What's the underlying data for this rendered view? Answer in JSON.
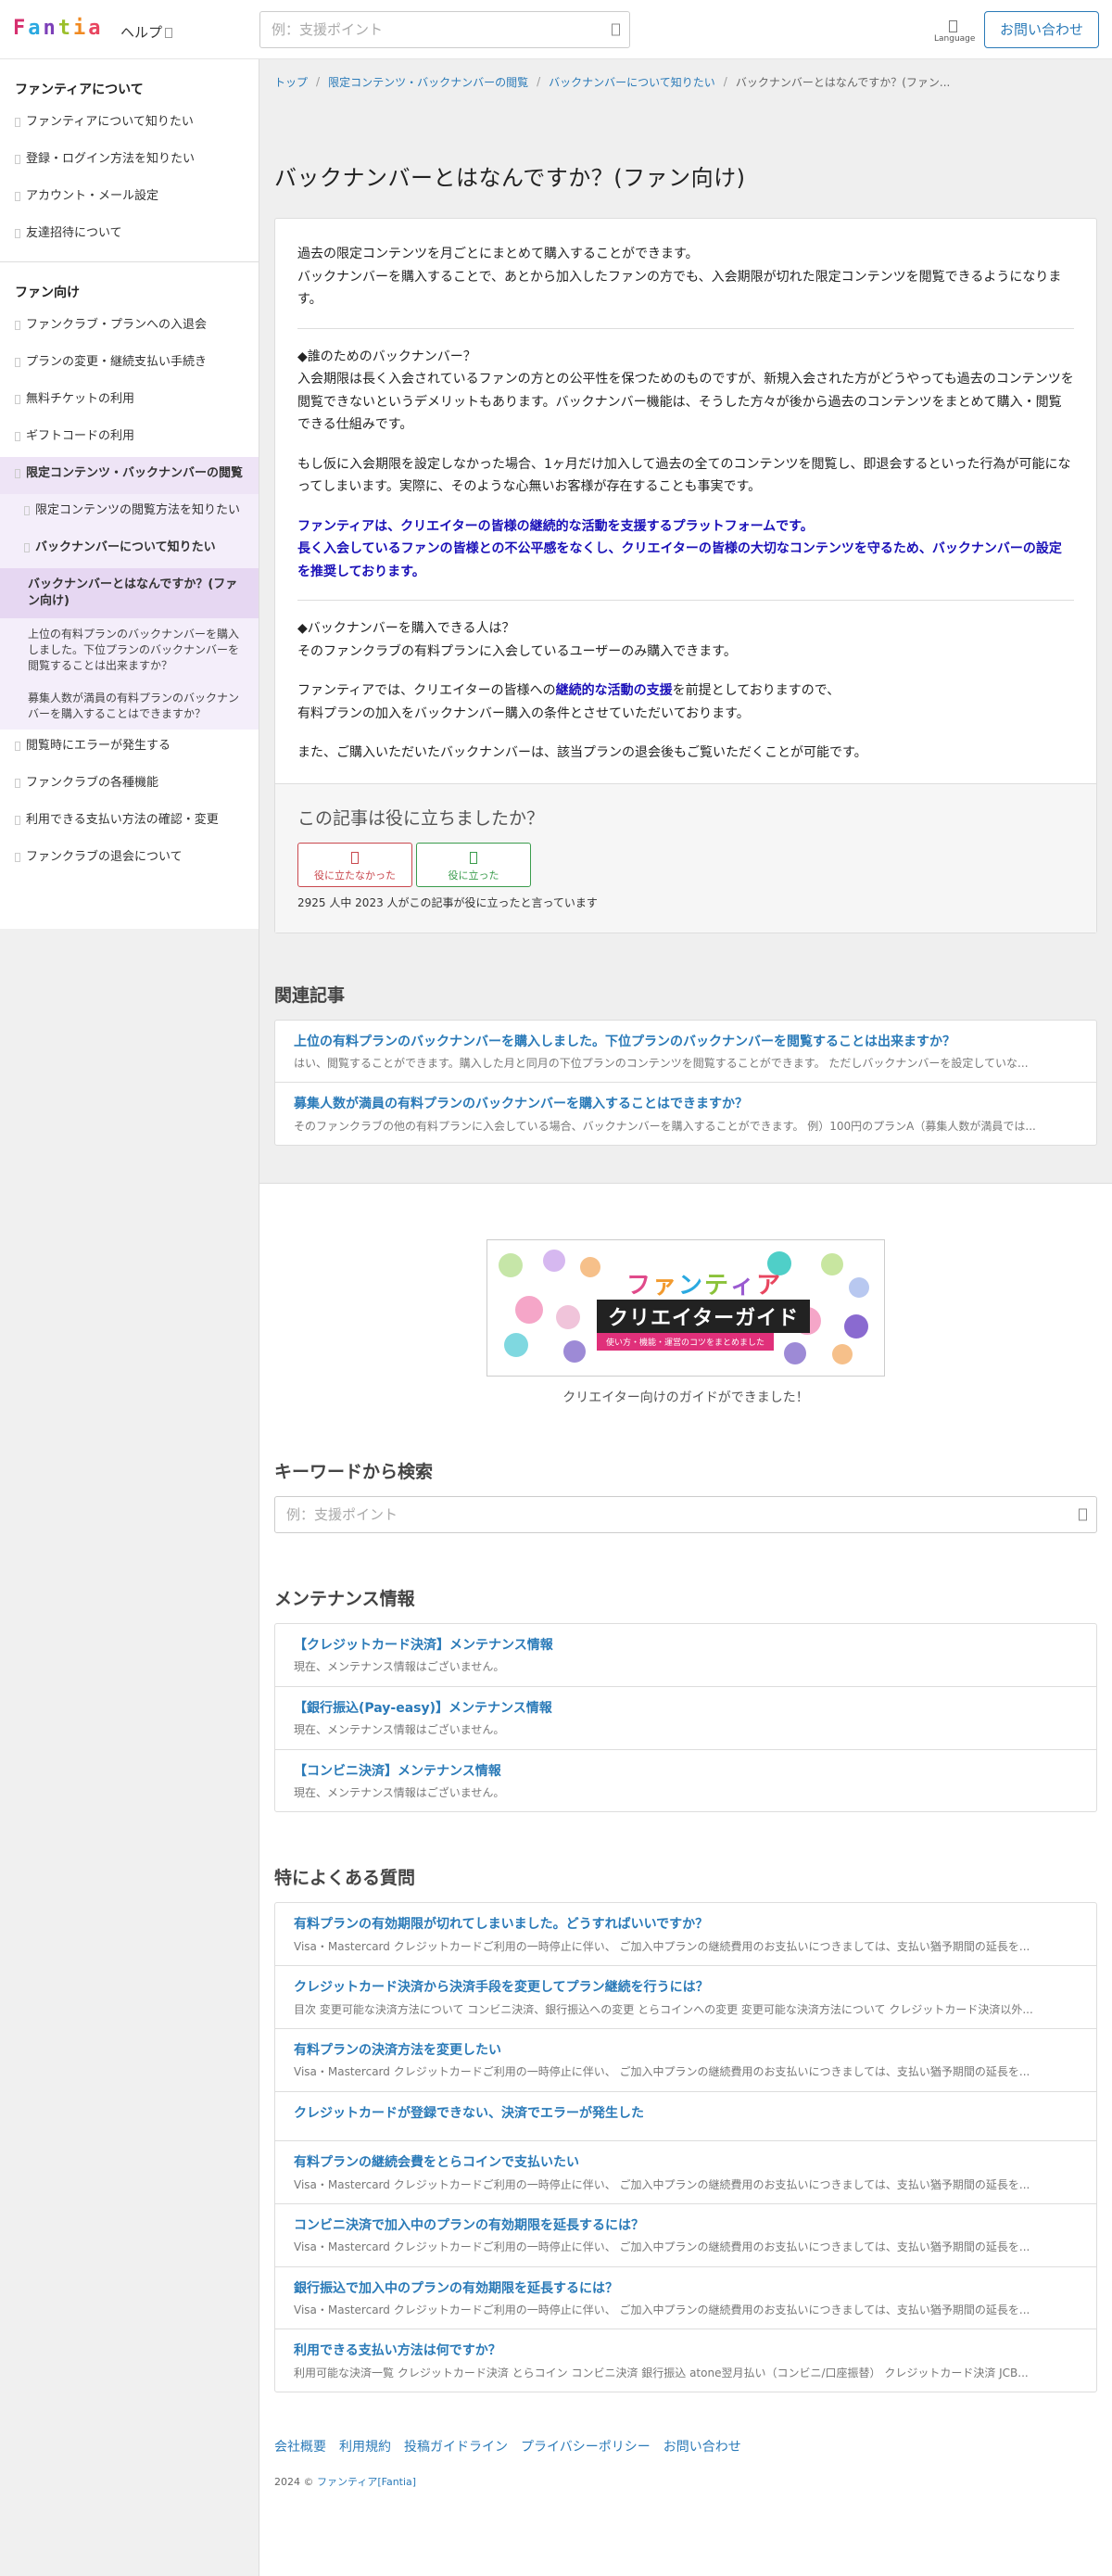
{
  "header": {
    "logo_letters": [
      "F",
      "a",
      "n",
      "t",
      "i",
      "a"
    ],
    "logo_colors": [
      "#d6306f",
      "#2aa9e0",
      "#7c3fb8",
      "#9bbf2a",
      "#f08a22",
      "#e8465f"
    ],
    "help_label": "ヘルプ",
    "search_placeholder": "例：支援ポイント",
    "language_label": "Language",
    "contact_label": "お問い合わせ"
  },
  "sidebar": {
    "section1": {
      "heading": "ファンティアについて",
      "items": [
        "ファンティアについて知りたい",
        "登録・ログイン方法を知りたい",
        "アカウント・メール設定",
        "友達招待について"
      ]
    },
    "section2": {
      "heading": "ファン向け",
      "items": [
        "ファンクラブ・プランへの入退会",
        "プランの変更・継続支払い手続き",
        "無料チケットの利用",
        "ギフトコードの利用"
      ],
      "active_parent": "限定コンテンツ・バックナンバーの閲覧",
      "sub1": "限定コンテンツの閲覧方法を知りたい",
      "sub2": "バックナンバーについて知りたい",
      "current": "バックナンバーとはなんですか？(ファン向け)",
      "subsub1": "上位の有料プランのバックナンバーを購入しました。下位プランのバックナンバーを閲覧することは出来ますか？",
      "subsub2": "募集人数が満員の有料プランのバックナンバーを購入することはできますか？",
      "after": [
        "閲覧時にエラーが発生する",
        "ファンクラブの各種機能",
        "利用できる支払い方法の確認・変更",
        "ファンクラブの退会について"
      ]
    }
  },
  "breadcrumb": {
    "items": [
      "トップ",
      "限定コンテンツ・バックナンバーの閲覧",
      "バックナンバーについて知りたい"
    ],
    "current": "バックナンバーとはなんですか？(ファン..."
  },
  "article": {
    "title": "バックナンバーとはなんですか？(ファン向け)",
    "intro1": "過去の限定コンテンツを月ごとにまとめて購入することができます。",
    "intro2": "バックナンバーを購入することで、あとから加入したファンの方でも、入会期限が切れた限定コンテンツを閲覧できるようになります。",
    "who_heading": "◆誰のためのバックナンバー？",
    "who_body": "入会期限は長く入会されているファンの方との公平性を保つためのものですが、新規入会された方がどうやっても過去のコンテンツを閲覧できないというデメリットもあります。バックナンバー機能は、そうした方々が後から過去のコンテンツをまとめて購入・閲覧できる仕組みです。",
    "if_body": "もし仮に入会期限を設定しなかった場合、1ヶ月だけ加入して過去の全てのコンテンツを閲覧し、即退会するといった行為が可能になってしまいます。実際に、そのような心無いお客様が存在することも事実です。",
    "emph1": "ファンティアは、クリエイターの皆様の継続的な活動を支援するプラットフォームです。",
    "emph2": "長く入会しているファンの皆様との不公平感をなくし、クリエイターの皆様の大切なコンテンツを守るため、バックナンバーの設定を推奨しております。",
    "can_heading": "◆バックナンバーを購入できる人は？",
    "can_body": "そのファンクラブの有料プランに入会しているユーザーのみ購入できます。",
    "premise_pre": "ファンティアでは、クリエイターの皆様への",
    "premise_emph": "継続的な活動の支援",
    "premise_post": "を前提としておりますので、",
    "premise_line2": "有料プランの加入をバックナンバー購入の条件とさせていただいております。",
    "also": "また、ご購入いただいたバックナンバーは、該当プランの退会後もご覧いただくことが可能です。"
  },
  "feedback": {
    "question": "この記事は役に立ちましたか？",
    "no_label": "役に立たなかった",
    "yes_label": "役に立った",
    "stats": "2925 人中 2023 人がこの記事が役に立ったと言っています"
  },
  "related": {
    "title": "関連記事",
    "items": [
      {
        "title": "上位の有料プランのバックナンバーを購入しました。下位プランのバックナンバーを閲覧することは出来ますか？",
        "snippet": "はい、閲覧することができます。購入した月と同月の下位プランのコンテンツを閲覧することができます。 ただしバックナンバーを設定していな..."
      },
      {
        "title": "募集人数が満員の有料プランのバックナンバーを購入することはできますか？",
        "snippet": "そのファンクラブの他の有料プランに入会している場合、バックナンバーを購入することができます。 例）100円のプランA（募集人数が満員では..."
      }
    ]
  },
  "banner": {
    "title_letters": [
      "フ",
      "ァ",
      "ン",
      "テ",
      "ィ",
      "ア"
    ],
    "title_colors": [
      "#e04a8a",
      "#f29a2e",
      "#2aa9e0",
      "#8bc23a",
      "#9a5ad0",
      "#e8465f"
    ],
    "subtitle": "クリエイターガイド",
    "tagline": "使い方・機能・運営のコツをまとめました",
    "caption": "クリエイター向けのガイドができました！"
  },
  "keyword_search": {
    "title": "キーワードから検索",
    "placeholder": "例：支援ポイント"
  },
  "maintenance": {
    "title": "メンテナンス情報",
    "items": [
      {
        "title": "【クレジットカード決済】メンテナンス情報",
        "snippet": "現在、メンテナンス情報はございません。"
      },
      {
        "title": "【銀行振込(Pay-easy)】メンテナンス情報",
        "snippet": "現在、メンテナンス情報はございません。"
      },
      {
        "title": "【コンビニ決済】メンテナンス情報",
        "snippet": "現在、メンテナンス情報はございません。"
      }
    ]
  },
  "faq": {
    "title": "特によくある質問",
    "items": [
      {
        "title": "有料プランの有効期限が切れてしまいました。どうすればいいですか？",
        "snippet": "Visa・Mastercard クレジットカードご利用の一時停止に伴い、 ご加入中プランの継続費用のお支払いにつきましては、支払い猶予期間の延長を..."
      },
      {
        "title": "クレジットカード決済から決済手段を変更してプラン継続を行うには？",
        "snippet": "目次 変更可能な決済方法について コンビニ決済、銀行振込への変更 とらコインへの変更 変更可能な決済方法について クレジットカード決済以外..."
      },
      {
        "title": "有料プランの決済方法を変更したい",
        "snippet": "Visa・Mastercard クレジットカードご利用の一時停止に伴い、 ご加入中プランの継続費用のお支払いにつきましては、支払い猶予期間の延長を..."
      },
      {
        "title": "クレジットカードが登録できない、決済でエラーが発生した",
        "snippet": ""
      },
      {
        "title": "有料プランの継続会費をとらコインで支払いたい",
        "snippet": "Visa・Mastercard クレジットカードご利用の一時停止に伴い、 ご加入中プランの継続費用のお支払いにつきましては、支払い猶予期間の延長を..."
      },
      {
        "title": "コンビニ決済で加入中のプランの有効期限を延長するには？",
        "snippet": "Visa・Mastercard クレジットカードご利用の一時停止に伴い、 ご加入中プランの継続費用のお支払いにつきましては、支払い猶予期間の延長を..."
      },
      {
        "title": "銀行振込で加入中のプランの有効期限を延長するには？",
        "snippet": "Visa・Mastercard クレジットカードご利用の一時停止に伴い、 ご加入中プランの継続費用のお支払いにつきましては、支払い猶予期間の延長を..."
      },
      {
        "title": "利用できる支払い方法は何ですか？",
        "snippet": "利用可能な決済一覧 クレジットカード決済 とらコイン コンビニ決済 銀行振込 atone翌月払い（コンビニ/口座振替） クレジットカード決済 JCB..."
      }
    ]
  },
  "footer": {
    "links": [
      "会社概要",
      "利用規約",
      "投稿ガイドライン",
      "プライバシーポリシー",
      "お問い合わせ"
    ],
    "copyright_prefix": "2024 © ",
    "copyright_link": "ファンティア[Fantia]"
  }
}
